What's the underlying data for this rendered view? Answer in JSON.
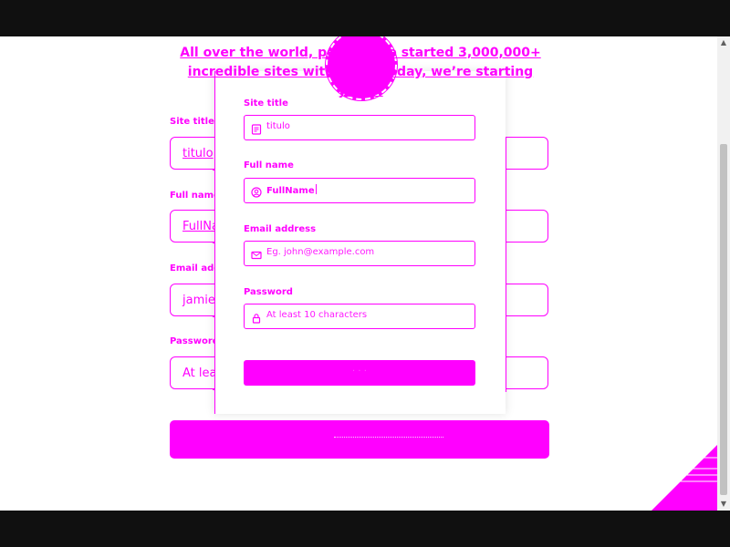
{
  "headline": {
    "line1_a": "All over the world, pe",
    "line1_b": "ple have started 3,000,000+",
    "line2_a": "incredible sites with Gh",
    "line2_b": "st. Today, we’re starting yours."
  },
  "background_form": {
    "site_title_label": "Site title",
    "site_title_value": "titulo",
    "full_name_label": "Full name",
    "full_name_value": "FullName",
    "email_label": "Email address",
    "email_value": "jamie@example.com",
    "password_label": "Password",
    "password_placeholder": "At least 10"
  },
  "card_form": {
    "site_title_label": "Site title",
    "site_title_value": "titulo",
    "full_name_label": "Full name",
    "full_name_value": "FullName",
    "email_label": "Email address",
    "email_placeholder": "Eg. john@example.com",
    "password_label": "Password",
    "password_placeholder": "At least 10 characters"
  },
  "icons": {
    "site_title": "document-icon",
    "full_name": "user-icon",
    "email": "mail-icon",
    "password": "lock-icon"
  },
  "colors": {
    "accent": "#ff00ff",
    "background": "#ffffff",
    "frame": "#101010"
  }
}
